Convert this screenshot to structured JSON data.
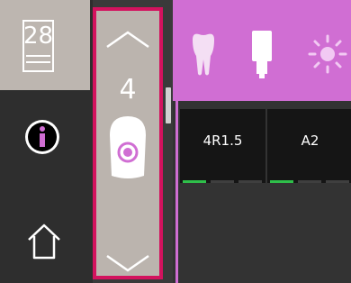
{
  "left_column": {
    "calendar_day": "28"
  },
  "selector": {
    "value": "4"
  },
  "top_bar": {
    "icons": [
      "tooth-icon",
      "cartridge-icon",
      "light-icon"
    ]
  },
  "cards": [
    {
      "label": "4R1.5",
      "active_segments": 1,
      "total_segments": 3
    },
    {
      "label": "A2",
      "active_segments": 1,
      "total_segments": 3
    }
  ],
  "colors": {
    "accent_magenta": "#d06ed3",
    "selector_border": "#d3125e",
    "indicator_green": "#2fbf4a"
  }
}
